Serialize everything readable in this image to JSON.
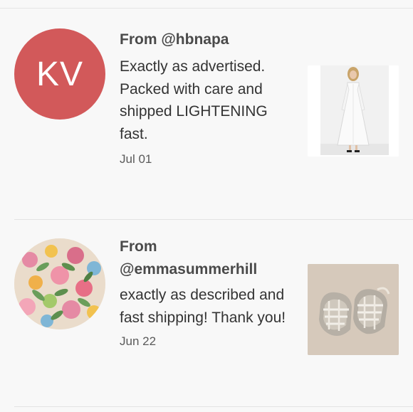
{
  "reviews": [
    {
      "avatar_initials": "KV",
      "from": "From @hbnapa",
      "text": "Exactly as advertised. Packed with care and shipped LIGHTENING fast.",
      "date": "Jul 01",
      "thumbnail": "white-dress-photo"
    },
    {
      "avatar_initials": "",
      "from": "From @emmasummerhill",
      "text": "exactly as described and fast shipping! Thank you!",
      "date": "Jun 22",
      "thumbnail": "baby-sandals-photo"
    }
  ],
  "colors": {
    "avatar_bg": "#d2595a",
    "background": "#f8f8f8"
  }
}
